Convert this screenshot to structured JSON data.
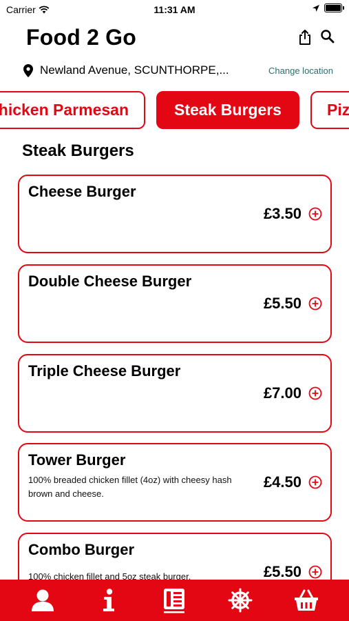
{
  "status": {
    "carrier": "Carrier",
    "time": "11:31 AM"
  },
  "header": {
    "title": "Food 2 Go"
  },
  "location": {
    "address": "Newland Avenue, SCUNTHORPE,...",
    "change_label": "Change location"
  },
  "categories": [
    {
      "label": "Chicken Parmesan"
    },
    {
      "label": "Steak Burgers"
    },
    {
      "label": "Pizza"
    }
  ],
  "section": {
    "title": "Steak Burgers"
  },
  "items": [
    {
      "name": "Cheese Burger",
      "description": "",
      "price": "£3.50"
    },
    {
      "name": "Double Cheese Burger",
      "description": "",
      "price": "£5.50"
    },
    {
      "name": "Triple Cheese Burger",
      "description": "",
      "price": "£7.00"
    },
    {
      "name": "Tower Burger",
      "description": "100% breaded chicken fillet (4oz) with cheesy hash brown and cheese.",
      "price": "£4.50"
    },
    {
      "name": "Combo Burger",
      "description": "100% chicken fillet and 5oz steak burger.",
      "price": "£5.50"
    }
  ],
  "colors": {
    "accent": "#e30613",
    "link": "#2c6e6e"
  },
  "tabbar": [
    {
      "icon": "person-icon"
    },
    {
      "icon": "info-icon"
    },
    {
      "icon": "menu-icon"
    },
    {
      "icon": "ship-wheel-icon"
    },
    {
      "icon": "basket-icon"
    }
  ]
}
